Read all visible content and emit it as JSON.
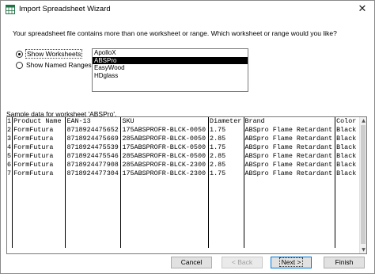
{
  "window": {
    "title": "Import Spreadsheet Wizard",
    "close_glyph": "✕"
  },
  "prompt": "Your spreadsheet file contains more than one worksheet or range. Which worksheet or range would you like?",
  "options": {
    "show_worksheets": {
      "label": "Show Worksheets",
      "checked": true
    },
    "show_named_ranges": {
      "label": "Show Named Ranges",
      "checked": false
    }
  },
  "worksheets": [
    "ApolloX",
    "ABSPro",
    "EasyWood",
    "HDglass"
  ],
  "selected_worksheet": "ABSPro",
  "sample_label": "Sample data for worksheet 'ABSPro'.",
  "grid": {
    "rows": [
      [
        "1",
        "Product Name",
        "EAN-13",
        "SKU",
        "Diameter",
        "Brand",
        "Color"
      ],
      [
        "2",
        "FormFutura",
        "8718924475652",
        "175ABSPROFR-BLCK-0050",
        "1.75",
        "ABSpro Flame Retardant",
        "Black"
      ],
      [
        "3",
        "FormFutura",
        "8718924475669",
        "285ABSPROFR-BLCK-0050",
        "2.85",
        "ABSpro Flame Retardant",
        "Black"
      ],
      [
        "4",
        "FormFutura",
        "8718924475539",
        "175ABSPROFR-BLCK-0500",
        "1.75",
        "ABSpro Flame Retardant",
        "Black"
      ],
      [
        "5",
        "FormFutura",
        "8718924475546",
        "285ABSPROFR-BLCK-0500",
        "2.85",
        "ABSpro Flame Retardant",
        "Black"
      ],
      [
        "6",
        "FormFutura",
        "8718924477908",
        "285ABSPROFR-BLCK-2300",
        "2.85",
        "ABSpro Flame Retardant",
        "Black"
      ],
      [
        "7",
        "FormFutura",
        "8718924477304",
        "175ABSPROFR-BLCK-2300",
        "1.75",
        "ABSpro Flame Retardant",
        "Black"
      ]
    ]
  },
  "buttons": {
    "cancel": "Cancel",
    "back": "< Back",
    "next": "Next >",
    "finish": "Finish"
  },
  "icons": {
    "app": "spreadsheet-icon",
    "close": "close-icon",
    "scroll_up": "scroll-up-arrow-icon",
    "scroll_down": "scroll-down-arrow-icon"
  },
  "colors": {
    "selection": "#000000",
    "default_button_border": "#0078d7",
    "grid_lines": "#000000",
    "app_icon_green": "#217346"
  }
}
